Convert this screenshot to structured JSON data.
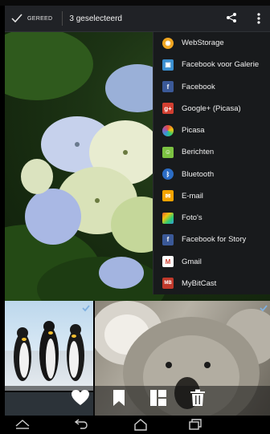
{
  "action_bar": {
    "done_label": "GEREED",
    "selection_label": "3 geselecteerd"
  },
  "share_menu": {
    "items": [
      {
        "label": "WebStorage",
        "icon": "webstorage-icon",
        "color": "#f0a520"
      },
      {
        "label": "Facebook voor Galerie",
        "icon": "gallery-icon",
        "color": "#3a8fd0"
      },
      {
        "label": "Facebook",
        "icon": "facebook-icon",
        "color": "#3b5998"
      },
      {
        "label": "Google+ (Picasa)",
        "icon": "google-plus-icon",
        "color": "#d23f31"
      },
      {
        "label": "Picasa",
        "icon": "picasa-icon",
        "color": "#8e44ad"
      },
      {
        "label": "Berichten",
        "icon": "messages-icon",
        "color": "#7cc242"
      },
      {
        "label": "Bluetooth",
        "icon": "bluetooth-icon",
        "color": "#2b6cc4"
      },
      {
        "label": "E-mail",
        "icon": "email-icon",
        "color": "#f4a300"
      },
      {
        "label": "Foto's",
        "icon": "photos-icon",
        "color": "#e55b2d"
      },
      {
        "label": "Facebook for Story",
        "icon": "facebook-story-icon",
        "color": "#3b5998"
      },
      {
        "label": "Gmail",
        "icon": "gmail-icon",
        "color": "#d23f31"
      },
      {
        "label": "MyBitCast",
        "icon": "mybitcast-icon",
        "color": "#c0392b"
      }
    ]
  }
}
